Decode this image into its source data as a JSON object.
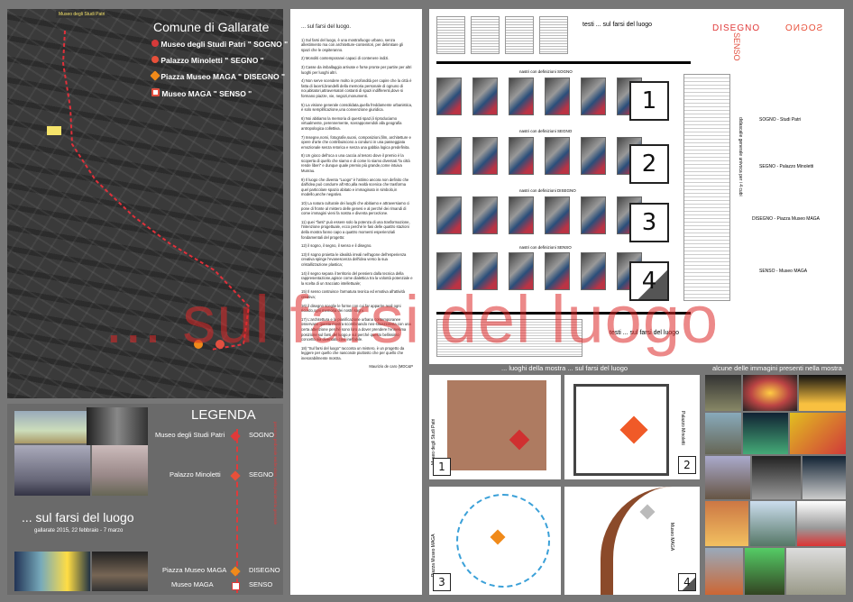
{
  "map": {
    "title": "Comune di Gallarate",
    "street_label": "Museo degli Studi Patri",
    "legend": [
      {
        "label": "Museo degli Studi Patri \" SOGNO \"",
        "color": "#d63a3a"
      },
      {
        "label": "Palazzo Minoletti \" SEGNO \"",
        "color": "#e8503a"
      },
      {
        "label": "Piazza Museo MAGA \" DISEGNO \"",
        "color": "#f08a1a"
      },
      {
        "label": "Museo MAGA \" SENSO \"",
        "color": "#e25040"
      }
    ]
  },
  "text": {
    "heading": "... sul farsi del luogo.",
    "paragraphs": [
      "1) Sul farsi del luogo, è una mostra/luogo urbano, senza allestimento ma con architetture-contenitori, per delimitare gli spazi che le ospiteranno.",
      "2) Monoliti contemporanei capaci di contenere indizi.",
      "3) Casse da imballaggio arrivate e forse pronte per partire per altri luoghi per luoghi altri.",
      "4) Non serve scendere molto in profondità per capire che la città è fatta di lacerti,brandelli della memoria personale di ognuno di noi,abitatori,attraversatori costanti di spazi indifferenti,dove si formano piazze, vie, negozi,monumenti.",
      "5) La visione generale consolidata,quella freddamente urbanistica, è solo semplificazione,una convenzione giuridica.",
      "6) Noi abitiamo la memoria di questi spazi,li riproduciamo virtualmente, perennemente, sovrapponendoli alla geografia antropologica collettiva.",
      "7) Insegne,nomi, fotografie,suoni, composizioni,film, architetture e opere d'arte che contribuiscono a condurci in una passeggiata emozionale senza retorica e senza una gabbia logica predefinita.",
      "8) Un gioco dell'oca o una caccia al tesoro dove il premio è la scoperta di quello che siamo e di come lo siamo diventati.\"la città rende liberi\" e dunque quale premio più grande,come intuiva Munrau.",
      "9) Il luogo che diventa \"Luogo\" è l'attimo ancora non definito che dall'idea può condurre all'Atto,alla realtà scenica che trasforma quel particolare spazio abitato e immaginato in simbolo,in modello,anche negativo.",
      "10) La natura culturale dei luoghi che abitiamo e attraversiamo ci pone di fronte al mistero delle genesi e al perché dei rimandi di come immagini vieni fa nostra e diventa percezione.",
      "11) quei \"farsi\" può essere solo la potenza di una trasformazione, l'intenzione progettuale, ecco perché le fasi delle quattro stazioni della mostra fanno capo a quattro momenti esperienziali fondamentali del progetto:",
      "12) il sogno, il segno, il senso e il disegno.",
      "13) Il sogno proietta le idealità irreali nell'agone dell'esperienza creativa spinge l'evanescenza dell'idea verso la sua cristallizzazione plastica;",
      "14) il segno separa il territorio del pensiero dalla tecnica della rappresentazione,agisce come dialettica tra la volontà potenziale e la scelta di un tracciato intellettuale;",
      "15) Il senso costruisce l'armatura teorica ed emotiva all'attività creativa;",
      "16) il disegno sceglie le forme con cui far apparire reali ogni ricordo,ogni memoria dei nostri sogni.",
      "17) L'architettura e la pianificazione urbana contemporanee osservano questa mostra scombinando neo-situazionista con una certa attenzione perché sono loro a dover prendere l'ennesima posizione sul farsi del luogo,e sul perché questo bellissimo concetto sia diventato così ineffabile.",
      "18) \"Sul farsi del luogo\" racconta un mistero, è un progetto da leggere per quello che nasconde piuttosto che per quello che inesorabilmente mostra."
    ],
    "signature": "Maurizio de caro (MDC&P"
  },
  "legend": {
    "title": "LEGENDA",
    "exhibition_title": "... sul farsi del luogo",
    "dates": "gallarate 2015, 22 febbraio - 7 marzo",
    "rows": [
      {
        "place": "Museo degli Studi Patri",
        "word": "SOGNO"
      },
      {
        "place": "Palazzo Minoletti",
        "word": "SEGNO"
      },
      {
        "place": "Piazza Museo MAGA",
        "word": "DISEGNO"
      },
      {
        "place": "Museo MAGA",
        "word": "SENSO"
      }
    ],
    "vertical_note": "percorso pedonale evidenziato nella planimetria generale"
  },
  "diagram": {
    "top_label": "testi ... sul farsi del luogo",
    "bottom_label": "testi ... sul farsi del luogo",
    "logo_words": [
      "DISEGNO",
      "SEGNO",
      "SENSO",
      "SOGNO"
    ],
    "rows": [
      {
        "ribbon": "nastri con definizioni SOGNO",
        "number": "1",
        "station": "SOGNO - Studi Patri"
      },
      {
        "ribbon": "nastri con definizioni SEGNO",
        "number": "2",
        "station": "SEGNO - Palazzo Minoletti"
      },
      {
        "ribbon": "nastri con definizioni DISEGNO",
        "number": "3",
        "station": "DISEGNO - Piazza Museo MAGA"
      },
      {
        "ribbon": "nastri con definizioni SENSO",
        "number": "4",
        "station": "SENSO - Museo MAGA"
      }
    ],
    "side_vertical": "didascalie generale univoca per i 4 cubi"
  },
  "overlay_title": "... sul farsi del luogo",
  "section_labels": {
    "places": "... luoghi della mostra ... sul farsi del luogo",
    "images": "alcune delle immagini presenti nella mostra"
  },
  "plans": [
    {
      "label": "Museo degli Studi Patri",
      "number": "1"
    },
    {
      "label": "Palazzo Minoletti",
      "number": "2"
    },
    {
      "label": "Piazza Museo MAGA",
      "number": "3"
    },
    {
      "label": "Museo MAGA",
      "number": "4"
    }
  ]
}
